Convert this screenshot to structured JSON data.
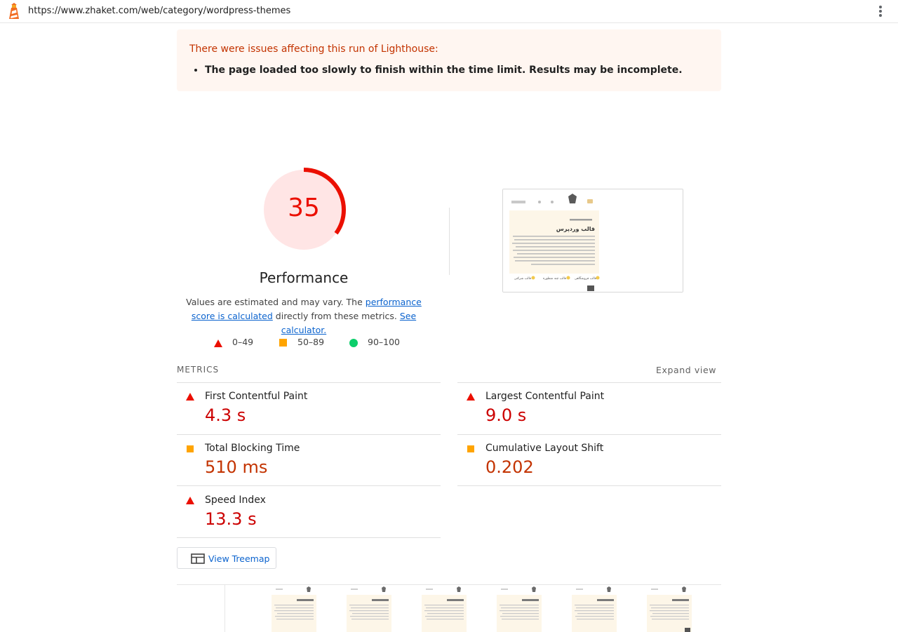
{
  "topbar": {
    "url": "https://www.zhaket.com/web/category/wordpress-themes"
  },
  "warning": {
    "title": "There were issues affecting this run of Lighthouse:",
    "items": [
      "The page loaded too slowly to finish within the time limit. Results may be incomplete."
    ]
  },
  "gauge": {
    "score": "35",
    "score_value": 35,
    "title": "Performance",
    "desc_prefix": "Values are estimated and may vary. The ",
    "desc_link1": "performance score is calculated",
    "desc_middle": " directly from these metrics. ",
    "desc_link2": "See calculator.",
    "color": "#eb0f00",
    "bg_color": "#ffe5e5"
  },
  "legend": [
    {
      "icon": "triangle-icon",
      "label": "0–49",
      "color": "#eb0f00"
    },
    {
      "icon": "square-icon",
      "label": "50–89",
      "color": "#ffa400"
    },
    {
      "icon": "circle-icon",
      "label": "90–100",
      "color": "#0cce6b"
    }
  ],
  "metrics": {
    "heading": "METRICS",
    "expand_label": "Expand view",
    "items": [
      {
        "label": "First Contentful Paint",
        "value": "4.3 s",
        "rating": "fail"
      },
      {
        "label": "Largest Contentful Paint",
        "value": "9.0 s",
        "rating": "fail"
      },
      {
        "label": "Total Blocking Time",
        "value": "510 ms",
        "rating": "average"
      },
      {
        "label": "Cumulative Layout Shift",
        "value": "0.202",
        "rating": "average"
      },
      {
        "label": "Speed Index",
        "value": "13.3 s",
        "rating": "fail"
      }
    ]
  },
  "treemap": {
    "label": "View Treemap"
  },
  "thumbnail": {
    "breadcrumb": "قالب وردپرس",
    "heading": "قالب وردپرس",
    "chips": [
      "قالب فروشگاهی",
      "قالب چند منظوره",
      "قالب شرکتی"
    ]
  },
  "colors": {
    "fail": "#cc0000",
    "average": "#c33300",
    "link": "#0b63ce"
  }
}
